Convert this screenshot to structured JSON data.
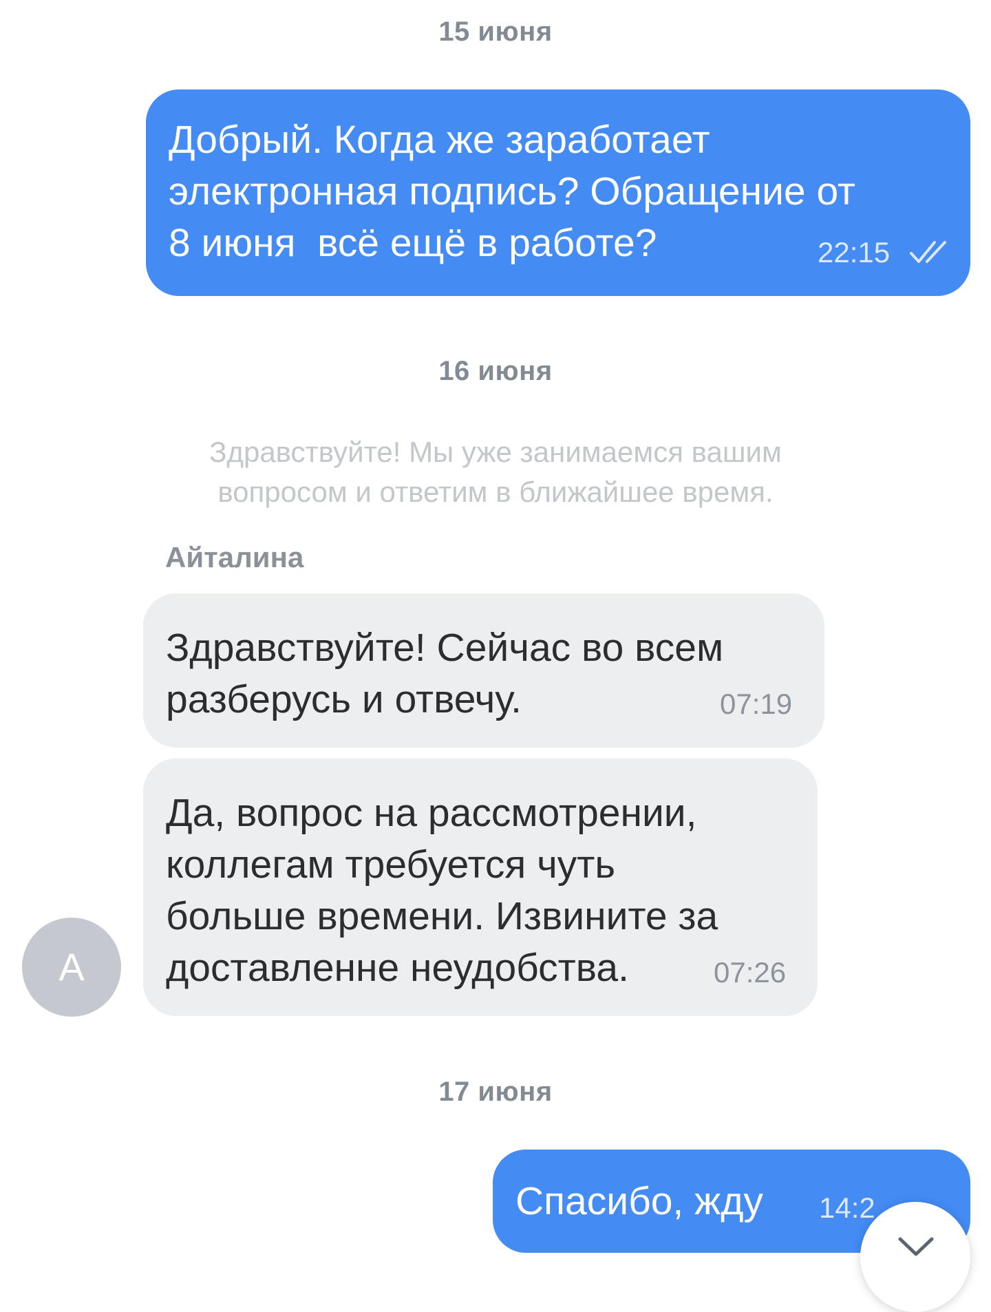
{
  "messages": [
    {
      "date": "15 июня",
      "text": "Добрый. Когда же заработает\nэлектронная подпись? Обращение от\n8 июня  всё ещё в работе?",
      "time": "22:15",
      "direction": "outgoing",
      "status_icon": "double-check-icon"
    },
    {
      "date": "16 июня",
      "system_text": "Здравствуйте! Мы уже занимаемся вашим\nвопросом и ответим в ближайшее время.",
      "sender": "Айталина"
    },
    {
      "text": "Здравствуйте! Сейчас во всем\nразберусь и отвечу.",
      "time": "07:19",
      "direction": "incoming"
    },
    {
      "text": "Да, вопрос на рассмотрении,\nколлегам требуется чуть\nбольше времени. Извините за\nдоставленне неудобства.",
      "time": "07:26",
      "direction": "incoming",
      "avatar_letter": "А"
    },
    {
      "date": "17 июня",
      "text": "Спасибо, жду",
      "time": "14:2",
      "direction": "outgoing"
    }
  ],
  "colors": {
    "outgoing_bubble": "#448bf3",
    "incoming_bubble": "#edeef0",
    "avatar": "#c5c9cf"
  },
  "scroll_button_icon": "chevron-down-icon"
}
